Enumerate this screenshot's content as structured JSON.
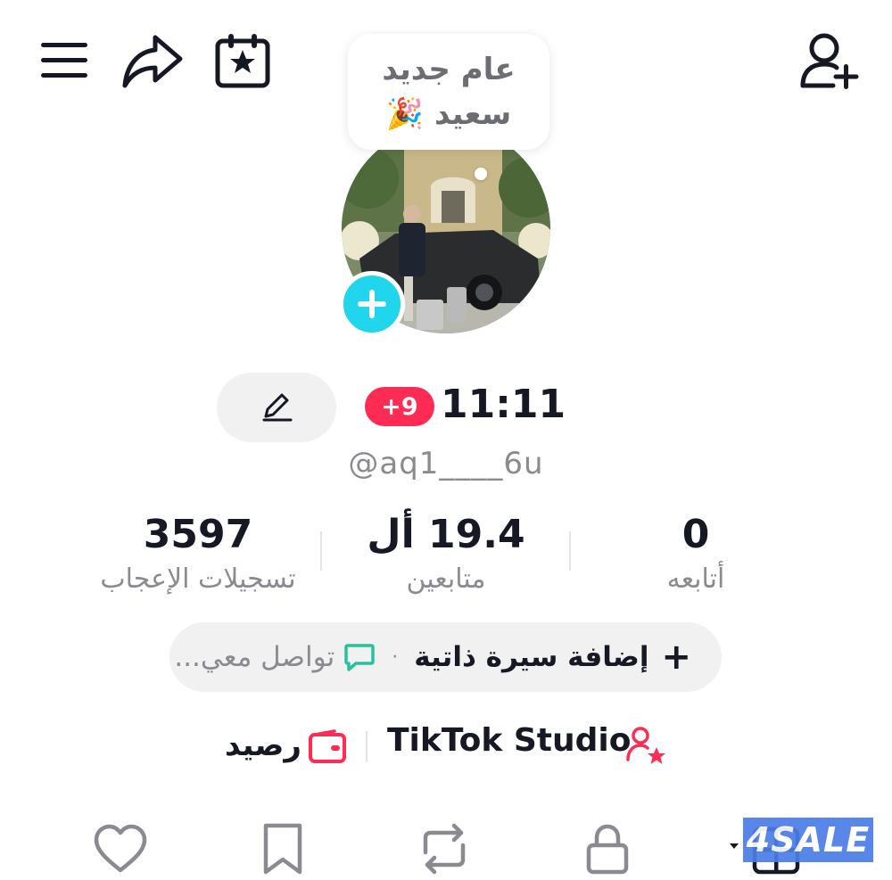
{
  "topbar": {
    "menu_icon": "hamburger-icon",
    "share_icon": "share-arrow-icon",
    "events_icon": "calendar-star-icon",
    "add_friend_icon": "add-user-icon"
  },
  "note": {
    "line1": "عام جديد",
    "line2": "سعيد 🎉"
  },
  "profile": {
    "display_name": "11:11",
    "notification_badge": "+9",
    "username": "@aq1____6u",
    "edit_icon": "pencil-icon"
  },
  "stats": {
    "likes": {
      "value": "3597",
      "label": "تسجيلات الإعجاب"
    },
    "followers": {
      "value": "19.4 أل",
      "label": "متابعين"
    },
    "following": {
      "value": "0",
      "label": "أتابعه"
    }
  },
  "bio": {
    "plus": "+",
    "add_bio": "إضافة سيرة ذاتية",
    "separator": "·",
    "contact": "تواصل معي..."
  },
  "tools": {
    "studio_label": "TikTok Studio",
    "balance_label": "رصيد"
  },
  "tabs": [
    {
      "name": "liked",
      "icon": "heart-outline-icon"
    },
    {
      "name": "favorites",
      "icon": "bookmark-icon"
    },
    {
      "name": "reposts",
      "icon": "repost-icon"
    },
    {
      "name": "private",
      "icon": "lock-icon"
    },
    {
      "name": "videos",
      "icon": "grid-icon"
    }
  ],
  "watermark": "4SALE",
  "colors": {
    "accent_red": "#fe2c55",
    "accent_cyan": "#20d5ec",
    "text_primary": "#161823",
    "text_secondary": "#8a8b91",
    "pill_bg": "#f1f1f2",
    "watermark_bg": "#4a7de8"
  }
}
